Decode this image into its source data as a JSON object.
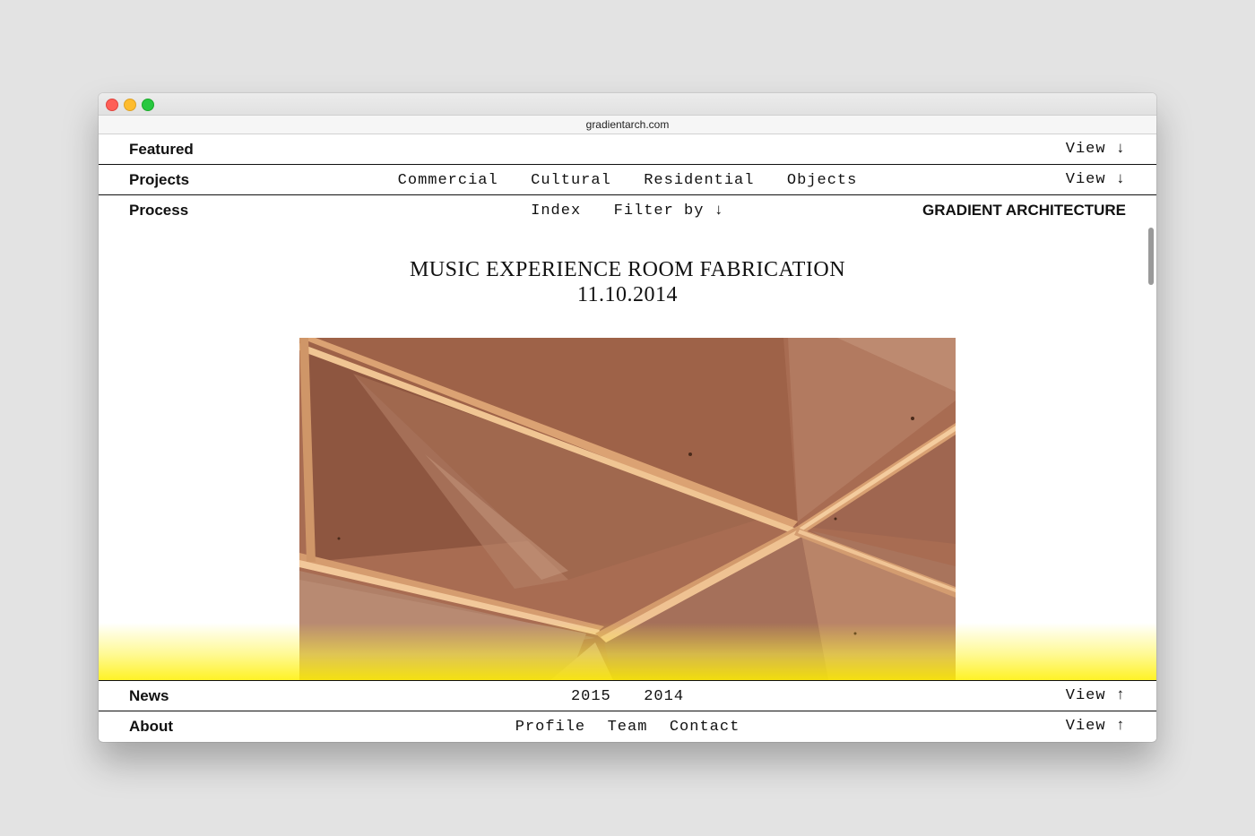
{
  "browser": {
    "url": "gradientarch.com"
  },
  "nav": {
    "featured": {
      "label": "Featured",
      "view": "View ↓"
    },
    "projects": {
      "label": "Projects",
      "links": [
        "Commercial",
        "Cultural",
        "Residential",
        "Objects"
      ],
      "view": "View ↓"
    },
    "process": {
      "label": "Process",
      "links": [
        "Index",
        "Filter by ↓"
      ],
      "brand": "GRADIENT ARCHITECTURE"
    },
    "news": {
      "label": "News",
      "links": [
        "2015",
        "2014"
      ],
      "view": "View ↑"
    },
    "about": {
      "label": "About",
      "links": [
        "Profile",
        "Team",
        "Contact"
      ],
      "view": "View ↑"
    }
  },
  "post": {
    "title": "MUSIC EXPERIENCE ROOM FABRICATION",
    "date": "11.10.2014"
  },
  "colors": {
    "accent_yellow": "#fff200",
    "text": "#111111",
    "photo_wood": "#a56a50"
  }
}
